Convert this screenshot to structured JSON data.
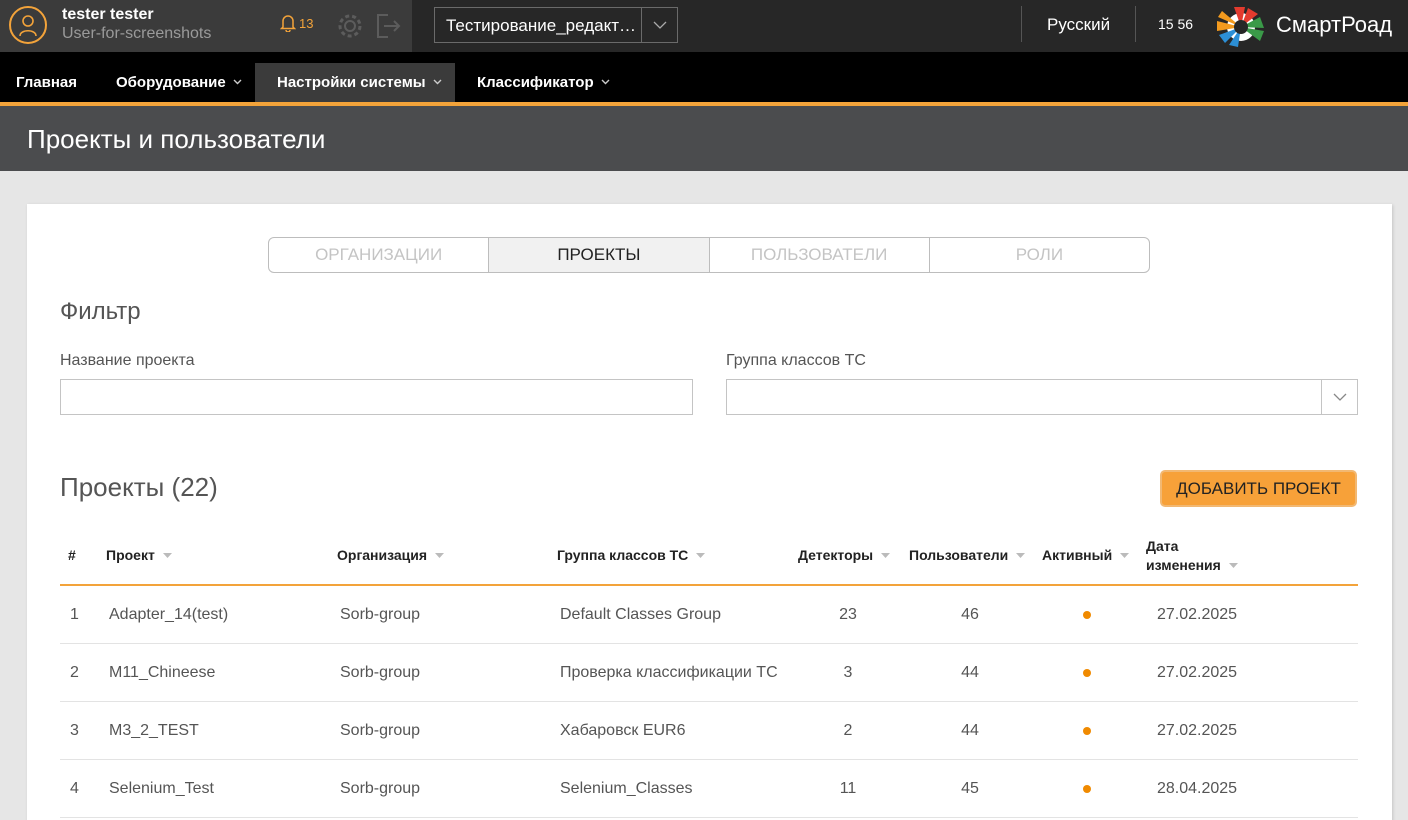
{
  "user": {
    "name": "tester tester",
    "login": "User-for-screenshots",
    "notifications": "13"
  },
  "project_select": {
    "value": "Тестирование_редакти..."
  },
  "language": "Русский",
  "time": "15 56",
  "brand": "СмартРоад",
  "nav": [
    {
      "label": "Главная"
    },
    {
      "label": "Оборудование"
    },
    {
      "label": "Настройки системы"
    },
    {
      "label": "Классификатор"
    }
  ],
  "page_title": "Проекты и пользователи",
  "tabs": [
    {
      "label": "ОРГАНИЗАЦИИ"
    },
    {
      "label": "ПРОЕКТЫ"
    },
    {
      "label": "ПОЛЬЗОВАТЕЛИ"
    },
    {
      "label": "РОЛИ"
    }
  ],
  "filter": {
    "title": "Фильтр",
    "name_label": "Название проекта",
    "name_value": "",
    "group_label": "Группа классов ТС",
    "group_value": ""
  },
  "projects": {
    "title": "Проекты (22)",
    "add_button": "ДОБАВИТЬ ПРОЕКТ",
    "columns": {
      "num": "#",
      "project": "Проект",
      "org": "Организация",
      "group": "Группа классов ТС",
      "detectors": "Детекторы",
      "users": "Пользователи",
      "active": "Активный",
      "date1": "Дата",
      "date2": "изменения"
    },
    "rows": [
      {
        "num": "1",
        "project": "Adapter_14(test)",
        "org": "Sorb-group",
        "group": "Default Classes Group",
        "detectors": "23",
        "users": "46",
        "date": "27.02.2025"
      },
      {
        "num": "2",
        "project": "M11_Chineese",
        "org": "Sorb-group",
        "group": "Проверка классификации ТС",
        "detectors": "3",
        "users": "44",
        "date": "27.02.2025"
      },
      {
        "num": "3",
        "project": "M3_2_TEST",
        "org": "Sorb-group",
        "group": "Хабаровск EUR6",
        "detectors": "2",
        "users": "44",
        "date": "27.02.2025"
      },
      {
        "num": "4",
        "project": "Selenium_Test",
        "org": "Sorb-group",
        "group": "Selenium_Classes",
        "detectors": "11",
        "users": "45",
        "date": "28.04.2025"
      }
    ]
  },
  "colors": {
    "accent": "#f3a33a",
    "active_dot": "#f08a00",
    "topbar": "#272727"
  }
}
